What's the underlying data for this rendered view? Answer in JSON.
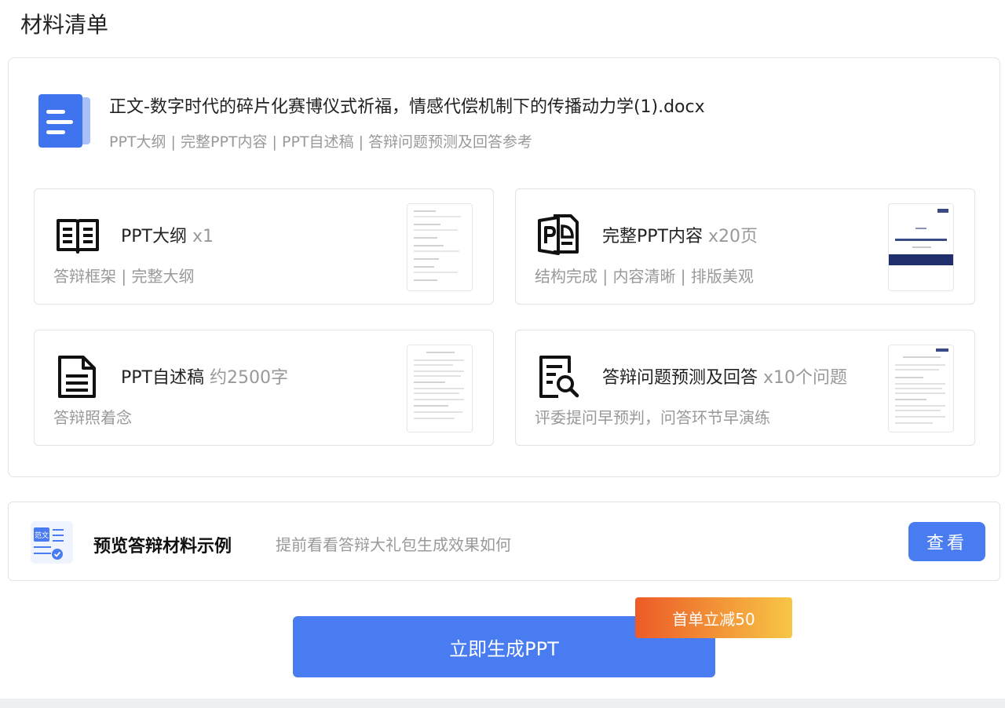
{
  "page_title": "材料清单",
  "document": {
    "filename": "正文-数字时代的碎片化赛博仪式祈福，情感代偿机制下的传播动力学(1).docx",
    "contents": "PPT大纲 | 完整PPT内容 | PPT自述稿 | 答辩问题预测及回答参考",
    "icon": "document-icon",
    "icon_color": "#3f74ee"
  },
  "items": [
    {
      "title": "PPT大纲",
      "quantity": "x1",
      "description": "答辩框架 | 完整大纲",
      "icon": "open-book-icon"
    },
    {
      "title": "完整PPT内容",
      "quantity": "x20页",
      "description": "结构完成 | 内容清晰 | 排版美观",
      "icon": "ppt-file-icon"
    },
    {
      "title": "PPT自述稿",
      "quantity": "约2500字",
      "description": "答辩照着念",
      "icon": "text-document-icon"
    },
    {
      "title": "答辩问题预测及回答",
      "quantity": "x10个问题",
      "description": "评委提问早预判，问答环节早演练",
      "icon": "document-search-icon"
    }
  ],
  "preview": {
    "icon_label": "范文",
    "title": "预览答辩材料示例",
    "description": "提前看看答辩大礼包生成效果如何",
    "button_label": "查看"
  },
  "generate_button": "立即生成PPT",
  "promo_badge": "首单立减50",
  "colors": {
    "primary": "#4a7cf1",
    "promo_start": "#ed5b27",
    "promo_end": "#f7c646",
    "muted_text": "#999999"
  }
}
